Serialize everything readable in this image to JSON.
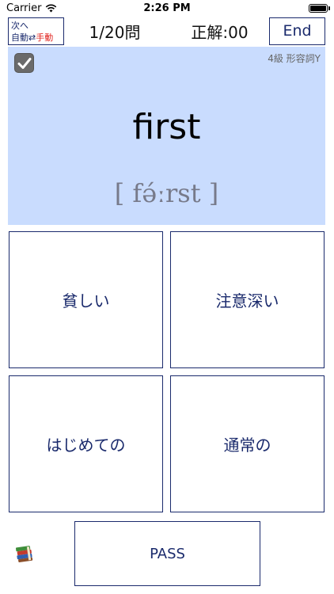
{
  "status_bar": {
    "carrier": "Carrier",
    "time": "2:26 PM",
    "battery_level": 1.0
  },
  "header": {
    "mode_line1": "次へ",
    "mode_auto": "自動",
    "mode_arrow": "⇄",
    "mode_manual": "手動",
    "question_counter": "1/20問",
    "score": "正解:00",
    "end_label": "End"
  },
  "card": {
    "level_tag": "4級  形容詞Y",
    "word": "first",
    "phonetic": "[ fə́ːrst ]",
    "checked": true
  },
  "answers": [
    {
      "label": "貧しい"
    },
    {
      "label": "注意深い"
    },
    {
      "label": "はじめての"
    },
    {
      "label": "通常の"
    }
  ],
  "footer": {
    "pass_label": "PASS",
    "book_icon": "books-icon"
  },
  "colors": {
    "accent": "#1a2a6c",
    "card_background": "#c9dcfe",
    "manual_red": "#e0211c"
  }
}
